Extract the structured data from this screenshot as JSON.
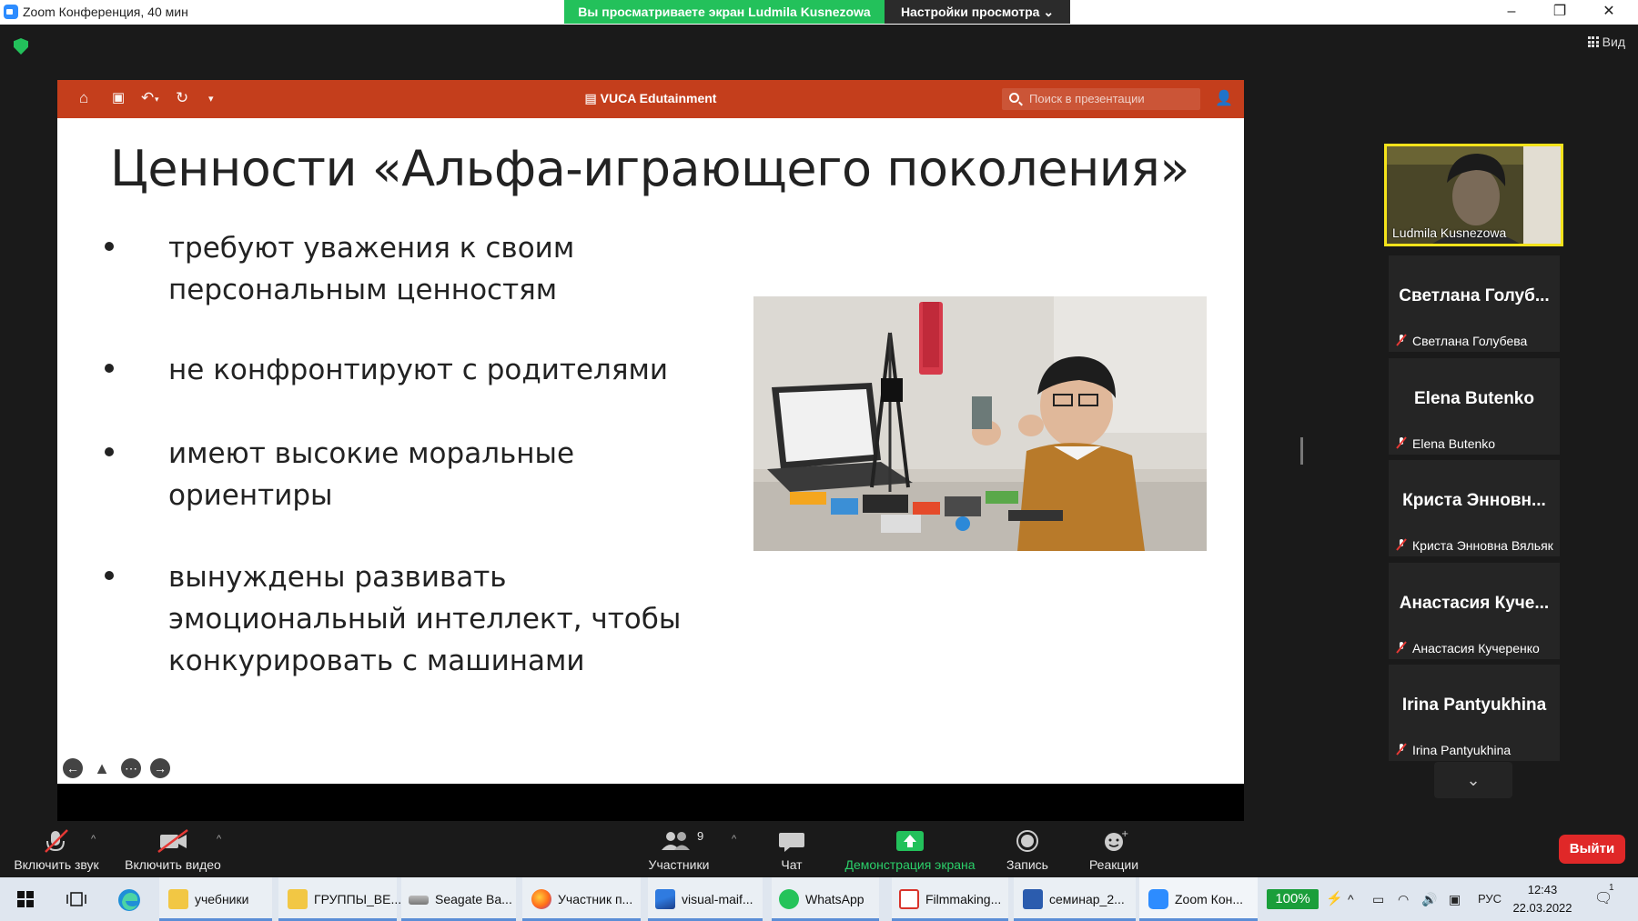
{
  "window": {
    "title": "Zoom Конференция, 40 мин",
    "share_banner": "Вы просматриваете экран Ludmila Kusnezowa",
    "view_settings": "Настройки просмотра",
    "view_label": "Вид"
  },
  "presentation": {
    "doc_title": "VUCA Edutainment",
    "search_placeholder": "Поиск в презентации",
    "slide": {
      "title": "Ценности «Альфа-играющего поколения»",
      "bullets": [
        "требуют уважения к своим персональным ценностям",
        "не конфронтируют с родителями",
        "имеют высокие моральные ориентиры",
        "вынуждены развивать эмоциональный интеллект, чтобы конкурировать с машинами"
      ]
    }
  },
  "participants": {
    "self": {
      "name": "Ludmila Kusnezowa"
    },
    "tiles": [
      {
        "display": "Светлана Голуб...",
        "name": "Светлана Голубева"
      },
      {
        "display": "Elena Butenko",
        "name": "Elena Butenko"
      },
      {
        "display": "Криста Энновн...",
        "name": "Криста Энновна Вяльяк"
      },
      {
        "display": "Анастасия Куче...",
        "name": "Анастасия Кучеренко"
      },
      {
        "display": "Irina Pantyukhina",
        "name": "Irina Pantyukhina"
      }
    ]
  },
  "toolbar": {
    "unmute": "Включить звук",
    "start_video": "Включить видео",
    "participants": "Участники",
    "participants_count": "9",
    "chat": "Чат",
    "share_screen": "Демонстрация экрана",
    "record": "Запись",
    "reactions": "Реакции",
    "leave": "Выйти"
  },
  "taskbar": {
    "items": [
      {
        "label": "учебники",
        "icon": "folder-icon"
      },
      {
        "label": "ГРУППЫ_ВЕ...",
        "icon": "folder-icon"
      },
      {
        "label": "Seagate Ba...",
        "icon": "drive-icon"
      },
      {
        "label": "Участник п...",
        "icon": "firefox-icon"
      },
      {
        "label": "visual-maif...",
        "icon": "image-icon"
      },
      {
        "label": "WhatsApp",
        "icon": "whatsapp-icon"
      },
      {
        "label": "Filmmaking...",
        "icon": "pdf-icon"
      },
      {
        "label": "семинар_2...",
        "icon": "word-icon"
      },
      {
        "label": "Zoom Кон...",
        "icon": "zoom-icon"
      }
    ],
    "battery": "100%",
    "language": "РУС",
    "time": "12:43",
    "date": "22.03.2022",
    "notifications": "1"
  },
  "colors": {
    "ppt_accent": "#c43e1c",
    "share_green": "#23c15b",
    "active_speaker": "#f5e31b",
    "leave_red": "#e02828"
  }
}
